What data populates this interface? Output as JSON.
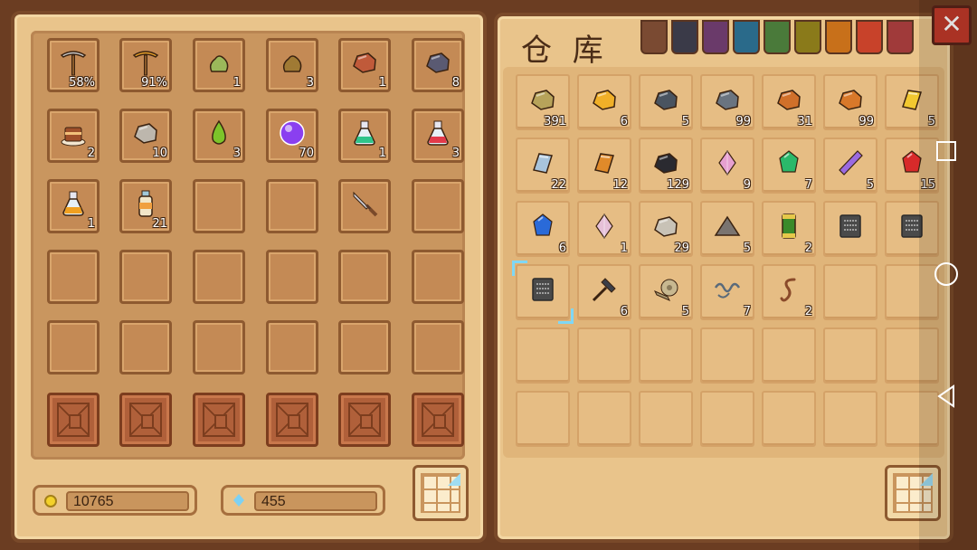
{
  "inventory": {
    "slots": [
      {
        "name": "iron-pickaxe-icon",
        "qty": "58%",
        "color": "#c8c8c8",
        "shape": "pick"
      },
      {
        "name": "gold-pickaxe-icon",
        "qty": "91%",
        "color": "#e8a12a",
        "shape": "pick"
      },
      {
        "name": "green-seed-icon",
        "qty": "1",
        "color": "#9bb85a",
        "shape": "blob"
      },
      {
        "name": "brown-seed-icon",
        "qty": "3",
        "color": "#a07a34",
        "shape": "blob"
      },
      {
        "name": "red-ore-icon",
        "qty": "1",
        "color": "#c05a3a",
        "shape": "rock"
      },
      {
        "name": "dark-ore-icon",
        "qty": "8",
        "color": "#5a5a72",
        "shape": "rock"
      },
      {
        "name": "cake-icon",
        "qty": "2",
        "color": "#a0502a",
        "shape": "cake"
      },
      {
        "name": "stone-icon",
        "qty": "10",
        "color": "#bdb7ad",
        "shape": "rock"
      },
      {
        "name": "green-droplet-icon",
        "qty": "3",
        "color": "#7cc42a",
        "shape": "drop"
      },
      {
        "name": "purple-orb-icon",
        "qty": "70",
        "color": "#8a3ff0",
        "shape": "orb"
      },
      {
        "name": "green-potion-icon",
        "qty": "1",
        "color": "#2fc48a",
        "shape": "potion"
      },
      {
        "name": "red-potion-icon",
        "qty": "3",
        "color": "#e23a4a",
        "shape": "potion"
      },
      {
        "name": "orange-potion-icon",
        "qty": "1",
        "color": "#f0a020",
        "shape": "potion"
      },
      {
        "name": "milk-bottle-icon",
        "qty": "21",
        "color": "#f2e6c8",
        "shape": "bottle"
      },
      {
        "name": "",
        "qty": "",
        "color": "",
        "shape": ""
      },
      {
        "name": "",
        "qty": "",
        "color": "",
        "shape": ""
      },
      {
        "name": "dagger-icon",
        "qty": "",
        "color": "#d0d0d8",
        "shape": "dagger"
      },
      {
        "name": "",
        "qty": "",
        "color": "",
        "shape": ""
      }
    ],
    "coins": "10765",
    "gems": "455"
  },
  "storage": {
    "title": "仓 库",
    "tab_colors": [
      "#7a4a32",
      "#3a3a48",
      "#6a3a6a",
      "#2a6a8a",
      "#4a7a3a",
      "#8a7a1a",
      "#c8701a",
      "#c8422a",
      "#a03a3a"
    ],
    "items": [
      {
        "name": "rough-stone-icon",
        "qty": "391",
        "color": "#b7a35a",
        "shape": "rock"
      },
      {
        "name": "gold-ore-icon",
        "qty": "6",
        "color": "#f0b028",
        "shape": "rock"
      },
      {
        "name": "coal-ore-icon",
        "qty": "5",
        "color": "#4a5460",
        "shape": "rock"
      },
      {
        "name": "iron-ore-icon",
        "qty": "99",
        "color": "#6a7480",
        "shape": "rock"
      },
      {
        "name": "copper-ore-icon",
        "qty": "31",
        "color": "#d0702a",
        "shape": "rock"
      },
      {
        "name": "copper-ore-2-icon",
        "qty": "99",
        "color": "#d8782a",
        "shape": "rock"
      },
      {
        "name": "gold-bar-icon",
        "qty": "5",
        "color": "#f2c830",
        "shape": "bar"
      },
      {
        "name": "silver-bar-icon",
        "qty": "22",
        "color": "#a8c4dc",
        "shape": "bar"
      },
      {
        "name": "copper-bar-icon",
        "qty": "12",
        "color": "#e08a2a",
        "shape": "bar"
      },
      {
        "name": "coal-icon",
        "qty": "129",
        "color": "#2a2a30",
        "shape": "rock"
      },
      {
        "name": "rainbow-crystal-icon",
        "qty": "9",
        "color": "#e6a0d0",
        "shape": "crystal"
      },
      {
        "name": "emerald-icon",
        "qty": "7",
        "color": "#2ab86a",
        "shape": "gem"
      },
      {
        "name": "amethyst-icon",
        "qty": "5",
        "color": "#9a6ae0",
        "shape": "shard"
      },
      {
        "name": "ruby-icon",
        "qty": "15",
        "color": "#d82a2a",
        "shape": "gem"
      },
      {
        "name": "sapphire-icon",
        "qty": "6",
        "color": "#2a6ad8",
        "shape": "gem"
      },
      {
        "name": "quartz-cluster-icon",
        "qty": "1",
        "color": "#e6c0d8",
        "shape": "crystal"
      },
      {
        "name": "stone-icon",
        "qty": "29",
        "color": "#c8c2b6",
        "shape": "rock"
      },
      {
        "name": "gravel-icon",
        "qty": "5",
        "color": "#7a7470",
        "shape": "pile"
      },
      {
        "name": "battery-icon",
        "qty": "2",
        "color": "#3a8a2a",
        "shape": "battery"
      },
      {
        "name": "blueprint-icon",
        "qty": "",
        "color": "#4a4a4a",
        "shape": "scroll"
      },
      {
        "name": "blueprint-2-icon",
        "qty": "",
        "color": "#4a4a4a",
        "shape": "scroll"
      },
      {
        "name": "blueprint-3-icon",
        "qty": "",
        "color": "#4a4a4a",
        "shape": "scroll"
      },
      {
        "name": "hammer-icon",
        "qty": "6",
        "color": "#3a3e48",
        "shape": "hammer"
      },
      {
        "name": "cloth-roll-icon",
        "qty": "5",
        "color": "#c8b890",
        "shape": "roll"
      },
      {
        "name": "string-icon",
        "qty": "7",
        "color": "#5a6a7a",
        "shape": "string"
      },
      {
        "name": "worm-icon",
        "qty": "2",
        "color": "#8a4a2a",
        "shape": "worm"
      }
    ]
  },
  "close_label": "✕"
}
